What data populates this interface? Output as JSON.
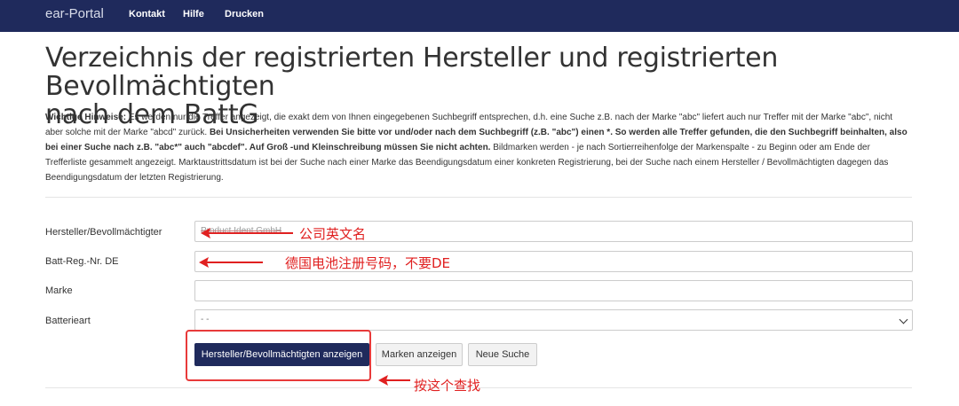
{
  "navbar": {
    "brand": "ear-Portal",
    "links": [
      "Kontakt",
      "Hilfe",
      "Drucken"
    ]
  },
  "page": {
    "title_line1": "Verzeichnis der registrierten Hersteller und registrierten Bevollmächtigten",
    "title_line2": "nach dem BattG"
  },
  "hints": {
    "label": "Wichtige Hinweise:",
    "part1": " Es werden nur die Treffer angezeigt, die exakt dem von Ihnen eingegebenen Suchbegriff entsprechen, d.h. eine Suche z.B. nach der Marke \"abc\" liefert auch nur Treffer mit der Marke \"abc\", nicht aber solche mit der Marke \"abcd\" zurück. ",
    "bold1": "Bei Unsicherheiten verwenden Sie bitte vor und/oder nach dem Suchbegriff (z.B. \"abc\") einen *. So werden alle Treffer gefunden, die den Suchbegriff beinhalten, also bei einer Suche nach z.B. \"abc*\" auch \"abcdef\". Auf Groß -und Kleinschreibung müssen Sie nicht achten.",
    "part2": " Bildmarken werden - je nach Sortierreihenfolge der Markenspalte - zu Beginn oder am Ende der Trefferliste gesammelt angezeigt. Marktaustrittsdatum ist bei der Suche nach einer Marke das Beendigungsdatum einer konkreten Registrierung, bei der Suche nach einem Hersteller / Bevollmächtigten dagegen das Beendigungsdatum der letzten Registrierung."
  },
  "form": {
    "manufacturer_label": "Hersteller/Bevollmächtigter",
    "manufacturer_value": "Product Ident GmbH",
    "regno_label": "Batt-Reg.-Nr. DE",
    "regno_value": "",
    "brand_label": "Marke",
    "brand_value": "",
    "batterytype_label": "Batterieart",
    "batterytype_value": "- -"
  },
  "buttons": {
    "show_manufacturers": "Hersteller/Bevollmächtigten anzeigen",
    "show_brands": "Marken anzeigen",
    "new_search": "Neue Suche"
  },
  "annotations": {
    "company_name": "公司英文名",
    "reg_number": "德国电池注册号码，不要DE",
    "search_hint": "按这个查找",
    "color": "#e02020"
  }
}
